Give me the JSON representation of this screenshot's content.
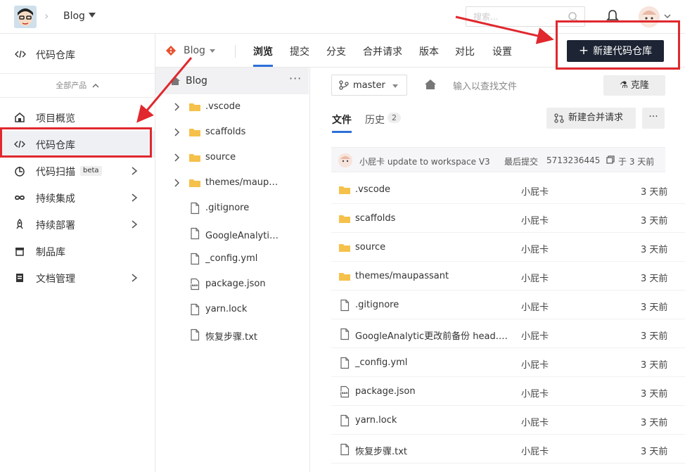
{
  "topbar": {
    "project": "Blog",
    "search_placeholder": "搜索..."
  },
  "sidebar": {
    "top_label": "代码仓库",
    "all_products": "全部产品",
    "items": [
      {
        "label": "项目概览",
        "icon": "dashboard-icon"
      },
      {
        "label": "代码仓库",
        "icon": "code-icon",
        "active": true
      },
      {
        "label": "代码扫描",
        "icon": "scan-icon",
        "badge": "beta",
        "chevron": true
      },
      {
        "label": "持续集成",
        "icon": "infinity-icon",
        "chevron": true
      },
      {
        "label": "持续部署",
        "icon": "rocket-icon",
        "chevron": true
      },
      {
        "label": "制品库",
        "icon": "package-icon"
      },
      {
        "label": "文档管理",
        "icon": "docs-icon",
        "chevron": true
      }
    ]
  },
  "repo_nav": {
    "repo": "Blog",
    "tabs": [
      "浏览",
      "提交",
      "分支",
      "合并请求",
      "版本",
      "对比",
      "设置"
    ],
    "new_repo_label": "新建代码仓库"
  },
  "tree": {
    "root": "Blog",
    "more": "···",
    "items": [
      {
        "name": ".vscode",
        "type": "folder"
      },
      {
        "name": "scaffolds",
        "type": "folder"
      },
      {
        "name": "source",
        "type": "folder"
      },
      {
        "name": "themes/maupassant",
        "type": "folder"
      },
      {
        "name": ".gitignore",
        "type": "file"
      },
      {
        "name": "GoogleAnalytic更改前备份 head.ejs",
        "type": "file"
      },
      {
        "name": "_config.yml",
        "type": "file"
      },
      {
        "name": "package.json",
        "type": "json"
      },
      {
        "name": "yarn.lock",
        "type": "file"
      },
      {
        "name": "恢复步骤.txt",
        "type": "file"
      }
    ]
  },
  "main": {
    "branch": "master",
    "find_placeholder": "输入以查找文件",
    "clone_label": "克隆",
    "files_tab": "文件",
    "history_tab": "历史",
    "history_count": "2",
    "new_mr_label": "新建合并请求",
    "more_label": "···",
    "commit": {
      "author_message": "小屁卡 update to workspace V3",
      "last_commit_label": "最后提交",
      "hash": "5713236445",
      "time": "于 3 天前"
    },
    "files": [
      {
        "name": ".vscode",
        "type": "folder",
        "author": "小屁卡",
        "time": "3 天前"
      },
      {
        "name": "scaffolds",
        "type": "folder",
        "author": "小屁卡",
        "time": "3 天前"
      },
      {
        "name": "source",
        "type": "folder",
        "author": "小屁卡",
        "time": "3 天前"
      },
      {
        "name": "themes/maupassant",
        "type": "folder",
        "author": "小屁卡",
        "time": "3 天前"
      },
      {
        "name": ".gitignore",
        "type": "file",
        "author": "小屁卡",
        "time": "3 天前"
      },
      {
        "name": "GoogleAnalytic更改前备份 head.ejs",
        "type": "file",
        "author": "小屁卡",
        "time": "3 天前"
      },
      {
        "name": "_config.yml",
        "type": "file",
        "author": "小屁卡",
        "time": "3 天前"
      },
      {
        "name": "package.json",
        "type": "json",
        "author": "小屁卡",
        "time": "3 天前"
      },
      {
        "name": "yarn.lock",
        "type": "file",
        "author": "小屁卡",
        "time": "3 天前"
      },
      {
        "name": "恢复步骤.txt",
        "type": "file",
        "author": "小屁卡",
        "time": "3 天前"
      }
    ]
  },
  "colors": {
    "accent": "#2d6fd8",
    "annotation_red": "#e0282e",
    "primary_button": "#1d2433",
    "folder": "#f5c14a"
  }
}
